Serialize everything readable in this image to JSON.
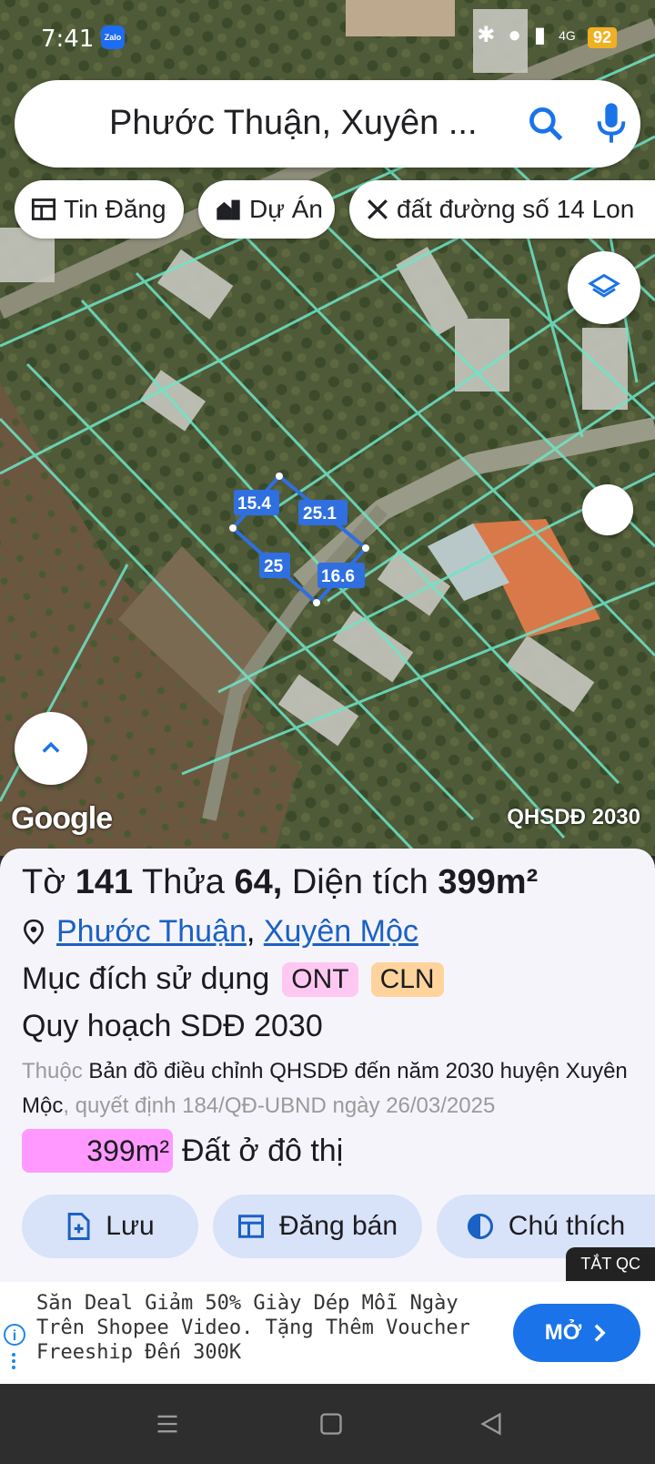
{
  "status": {
    "time": "7:41",
    "zalo_label": "Zalo",
    "battery": "92",
    "network": "4G"
  },
  "search": {
    "query": "Phước Thuận, Xuyên ...",
    "search_icon": "search-icon",
    "mic_icon": "microphone-icon"
  },
  "chips": [
    {
      "label": "Tin Đăng",
      "icon": "listing-icon"
    },
    {
      "label": "Dự Án",
      "icon": "buildings-icon"
    },
    {
      "label": "đất đường số 14 Lon",
      "icon": "tools-icon"
    }
  ],
  "map": {
    "measurements": [
      "15.4",
      "25.1",
      "25",
      "16.6"
    ],
    "google_label": "Google",
    "layer_label": "QHSDĐ 2030"
  },
  "info": {
    "title": {
      "prefix": "Tờ",
      "sheet": "141",
      "parcel_label": "Thửa",
      "parcel": "64,",
      "area_label": "Diện tích",
      "area": "399m²"
    },
    "location": {
      "ward": "Phước Thuận",
      "separator": ",",
      "district": "Xuyên Mộc"
    },
    "purpose": {
      "label": "Mục đích sử dụng",
      "codes": [
        "ONT",
        "CLN"
      ]
    },
    "plan_title": "Quy hoạch SDĐ 2030",
    "plan_desc": {
      "prefix": "Thuộc",
      "main": "Bản đồ điều chỉnh QHSDĐ đến năm 2030 huyện Xuyên Mộc",
      "decision": ", quyết định 184/QĐ-UBND ngày 26/03/2025"
    },
    "plan_area": {
      "value": "399m²",
      "label": "Đất ở đô thị"
    }
  },
  "actions": {
    "save": "Lưu",
    "post": "Đăng bán",
    "legend": "Chú thích"
  },
  "ad": {
    "close_label": "TẮT QC",
    "text": "Săn Deal Giảm 50% Giày Dép Mỗi Ngày Trên Shopee Video. Tặng Thêm Voucher Freeship Đến 300K",
    "open_label": "MỞ"
  },
  "colors": {
    "accent": "#1a73e8",
    "parcel_line": "#2f6fe0",
    "ont": "#ffc8f2",
    "cln": "#ffd39c",
    "plan_area": "#ff99ff"
  }
}
